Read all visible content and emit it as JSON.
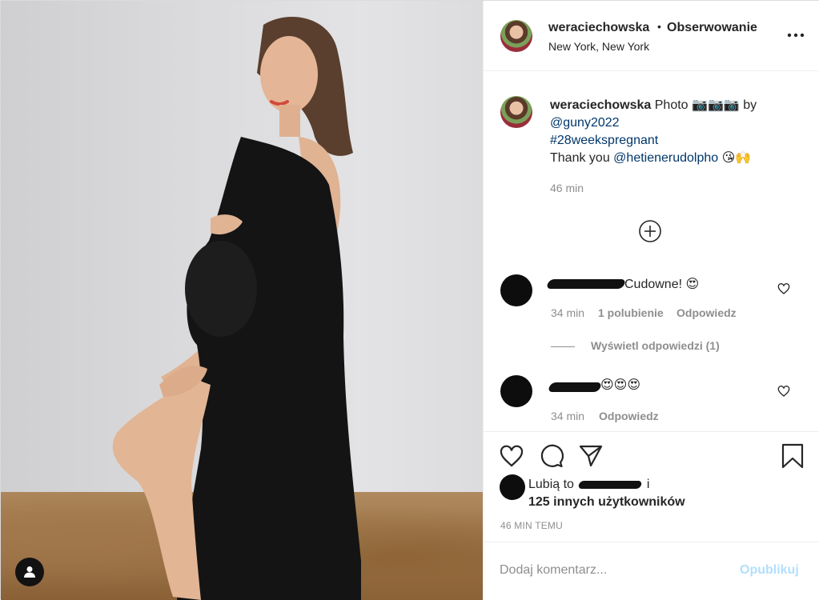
{
  "post": {
    "photo": {
      "tag_icon": "person-icon"
    },
    "header": {
      "username": "weraciechowska",
      "separator": "•",
      "follow_label": "Obserwowanie",
      "location": "New York, New York",
      "more_icon": "more-dots-icon"
    },
    "caption": {
      "username": "weraciechowska",
      "text_photo": "Photo",
      "camera_emoji": "📷📷📷",
      "by": "by",
      "photographer": "@guny2022",
      "hashtag": "#28weekspregnant",
      "thanks": "Thank you",
      "thanks_mention": "@hetienerudolpho",
      "thanks_emoji": "😘🙌",
      "time": "46 min"
    },
    "load_more_icon": "plus-circle-icon",
    "comments": [
      {
        "text": "Cudowne! 😍",
        "time": "34 min",
        "likes": "1 polubienie",
        "reply": "Odpowiedz"
      },
      {
        "text": "😍😍😍",
        "time": "34 min",
        "reply": "Odpowiedz"
      }
    ],
    "view_replies": "Wyświetl odpowiedzi (1)",
    "actions": {
      "like_icon": "heart-icon",
      "comment_icon": "comment-bubble-icon",
      "share_icon": "paper-plane-icon",
      "save_icon": "bookmark-icon"
    },
    "likes": {
      "prefix": "Lubią to",
      "suffix": "i",
      "others": "125 innych użytkowników"
    },
    "post_time": "46 MIN TEMU",
    "add_comment": {
      "placeholder": "Dodaj komentarz...",
      "publish": "Opublikuj"
    }
  }
}
